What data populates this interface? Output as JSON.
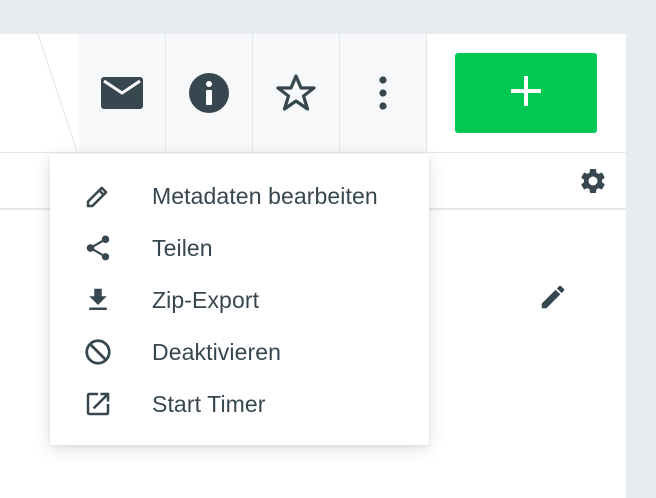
{
  "colors": {
    "background": "#e8ebf0",
    "panel": "#ffffff",
    "icon": "#37474f",
    "accent_green": "#00c853",
    "add_icon": "#ffffff"
  },
  "toolbar": {
    "buttons": [
      {
        "name": "mail",
        "icon": "mail-icon"
      },
      {
        "name": "info",
        "icon": "info-icon"
      },
      {
        "name": "favorite",
        "icon": "star-icon"
      },
      {
        "name": "more",
        "icon": "more-vertical-icon"
      }
    ],
    "add_icon": "plus-icon"
  },
  "subbar": {
    "settings_icon": "gear-icon"
  },
  "content": {
    "edit_icon": "pencil-icon"
  },
  "menu": {
    "items": [
      {
        "label": "Metadaten bearbeiten",
        "icon": "pencil-icon"
      },
      {
        "label": "Teilen",
        "icon": "share-icon"
      },
      {
        "label": "Zip-Export",
        "icon": "download-icon"
      },
      {
        "label": "Deaktivieren",
        "icon": "block-icon"
      },
      {
        "label": "Start Timer",
        "icon": "open-in-new-icon"
      }
    ]
  }
}
